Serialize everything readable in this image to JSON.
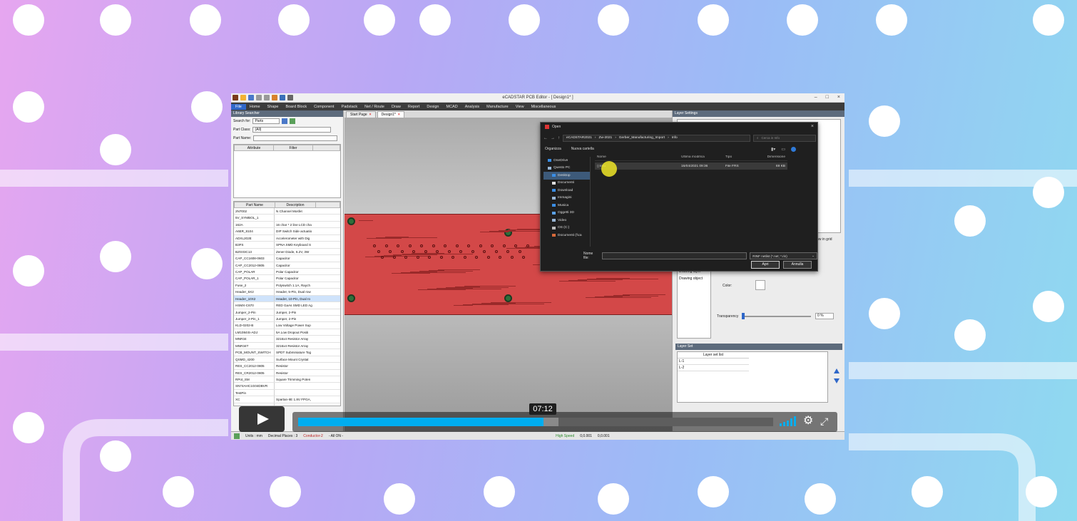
{
  "app": {
    "window_title": "eCADSTAR PCB Editor - [ Design1* ]",
    "menu": [
      "File",
      "Home",
      "Shape",
      "Board Block",
      "Component",
      "Padstack",
      "Net / Route",
      "Draw",
      "Report",
      "Design",
      "MCAD",
      "Analysis",
      "Manufacture",
      "View",
      "Miscellaneous"
    ]
  },
  "library": {
    "panel_title": "Library Searcher",
    "search_label": "Search for:",
    "search_value": "Parts",
    "part_class_label": "Part Class:",
    "part_class_value": "(All)",
    "part_name_label": "Part Name:",
    "attr_headers": [
      "Attribute",
      "Filter"
    ],
    "parts_headers": [
      "Part Name",
      "Description"
    ],
    "parts": [
      [
        "2N7002",
        "N Channel Mosfet"
      ],
      [
        "5V_SYMBOL_1",
        ""
      ],
      [
        "162A",
        "16 char * 2 line LCD cha"
      ],
      [
        "A6ER_8104",
        "DIP Switch Side actuatio"
      ],
      [
        "ADXL202E",
        "Accelerometer with Dig"
      ],
      [
        "B3FS",
        "SPNA SMD Keyboard S"
      ],
      [
        "BZG03C13",
        "Zener Diode, 6.2V, 3W"
      ],
      [
        "CAP_CC1608-0603",
        "Capacitor"
      ],
      [
        "CAP_CC2012-0805",
        "Capacitor"
      ],
      [
        "CAP_POLAR",
        "Polar Capacitor"
      ],
      [
        "CAP_POLAR_1",
        "Polar Capacitor"
      ],
      [
        "Fuse_2",
        "Polyswitch 1.1A, Raych"
      ],
      [
        "Header_5X2",
        "Header, 5-Pin, Dual row"
      ],
      [
        "Header_10X2",
        "Header, 10-Pin, Dual ro"
      ],
      [
        "HSMX-C670",
        "RED GaAs SMD LED Ag"
      ],
      [
        "Jumper_2-Pin",
        "Jumper, 2-Pin"
      ],
      [
        "Jumper_2-Pin_1",
        "Jumper, 2-Pin"
      ],
      [
        "KLD-0202-B",
        "Low Voltage Power Sup"
      ],
      [
        "LM1084IS-ADJ",
        "5A Low Dropout Positi"
      ],
      [
        "MNR34",
        "3216x4 Resistor Array"
      ],
      [
        "MNR34T",
        "3216x4 Resistor Array"
      ],
      [
        "PCB_MOUNT_SWITCH",
        "SPDT Subminiature Tog"
      ],
      [
        "QSMD_4200",
        "Surface Mount Crystal"
      ],
      [
        "RES_CC2012-0805",
        "Resistor"
      ],
      [
        "RES_CR2012-0805",
        "Resistor"
      ],
      [
        "RPot_SM",
        "Square Trimming Poten"
      ],
      [
        "SN74AHC1G04DBVR",
        ""
      ],
      [
        "TestPin",
        ""
      ],
      [
        "XC",
        "Spartan-IIE 1.8V FPGA,"
      ],
      [
        "XC",
        "Spartan-IIE FPGA"
      ]
    ],
    "selected_index": 13
  },
  "tabs": [
    {
      "label": "Start Page"
    },
    {
      "label": "Design1*"
    }
  ],
  "layer_settings": {
    "panel_title": "Layer Settings",
    "show_in_grid": "Show in grid",
    "drawing_layer": "Drawing layer",
    "drawing_object": "Drawing object",
    "color_label": "Color:",
    "transparency_label": "Transparency",
    "transparency_value": "0 %"
  },
  "layer_set": {
    "panel_title": "Layer Set",
    "list_header": "Layer set list",
    "items": [
      "L-1",
      "L-2"
    ]
  },
  "dialog": {
    "title": "Open",
    "breadcrumb": [
      "eCADSTAR2021",
      "Zw-2021",
      "Gerber_Manufacturing_Import",
      "Info"
    ],
    "search_placeholder": "Cerca in Info",
    "organize": "Organizza",
    "new_folder": "Nuova cartella",
    "nav": [
      {
        "label": "OneDrive",
        "color": "#3a8ee6",
        "indent": false
      },
      {
        "label": "Questo PC",
        "color": "#9ab7d6",
        "indent": false
      },
      {
        "label": "Desktop",
        "color": "#3a8ee6",
        "indent": true
      },
      {
        "label": "Documenti",
        "color": "#dddddd",
        "indent": true
      },
      {
        "label": "Download",
        "color": "#3a8ee6",
        "indent": true
      },
      {
        "label": "Immagini",
        "color": "#9ab7d6",
        "indent": true
      },
      {
        "label": "Musica",
        "color": "#3a8ee6",
        "indent": true
      },
      {
        "label": "Oggetti 3D",
        "color": "#5aa0e6",
        "indent": true
      },
      {
        "label": "Video",
        "color": "#9ab7d6",
        "indent": true
      },
      {
        "label": "OS (C:)",
        "color": "#bbbbbb",
        "indent": true
      },
      {
        "label": "Documenti (\\\\ca",
        "color": "#d86a3a",
        "indent": true
      }
    ],
    "selected_nav": 2,
    "columns": [
      "Nome",
      "Ultima modifica",
      "Tipo",
      "Dimensione"
    ],
    "files": [
      {
        "name": "Info",
        "modified": "16/04/2021 09:36",
        "type": "File FRS",
        "size": "69 KB"
      }
    ],
    "filename_label": "Nome file:",
    "filter": "RINF netlist (*.net; *.rin)",
    "open_button": "Apri",
    "cancel_button": "Annulla"
  },
  "statusbar": {
    "units": "Units : mm",
    "decimal": "Decimal Places : 3",
    "conductor": "Conductor-2",
    "all_on": "- All ON -",
    "speed": "High Speed",
    "grid1": "0,0.001",
    "grid2": "0,0.001"
  },
  "video": {
    "timecode": "07:12",
    "progress": 0.516,
    "buffered": 0.548
  },
  "colors": {
    "accent": "#00adef",
    "pcb": "#d34848"
  }
}
